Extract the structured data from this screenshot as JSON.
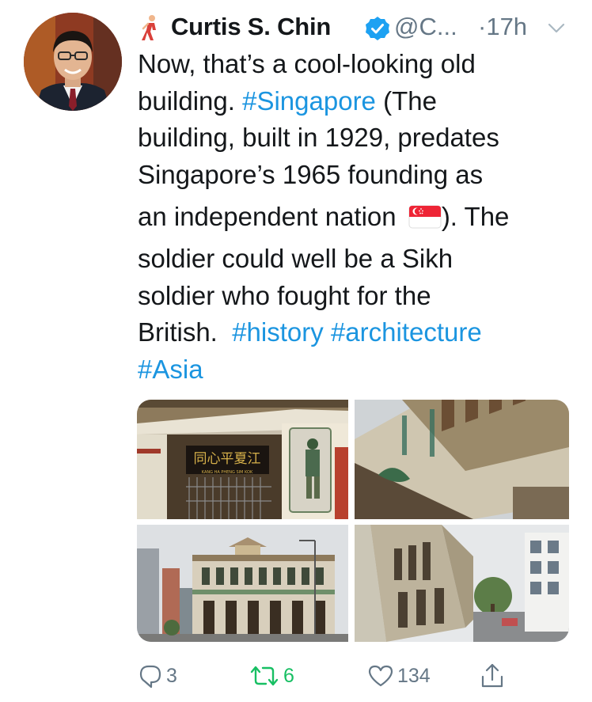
{
  "tweet": {
    "display_name": "Curtis S. Chin",
    "handle": "@C...",
    "timestamp": "·17h",
    "verified": true,
    "header_emoji": "person-walking-icon",
    "text_lines": [
      {
        "segments": [
          {
            "text": "Now, that’s a cool-looking old",
            "type": "text"
          }
        ]
      },
      {
        "segments": [
          {
            "text": "building. ",
            "type": "text"
          },
          {
            "text": "#Singapore",
            "type": "hashtag"
          },
          {
            "text": " (The",
            "type": "text"
          }
        ]
      },
      {
        "segments": [
          {
            "text": "building, built in 1929, predates",
            "type": "text"
          }
        ]
      },
      {
        "segments": [
          {
            "text": "Singapore’s 1965 founding as",
            "type": "text"
          }
        ]
      },
      {
        "segments": [
          {
            "text": "an independent nation ",
            "type": "text"
          },
          {
            "text": "flag-singapore-icon",
            "type": "flag"
          },
          {
            "text": "). The",
            "type": "text"
          }
        ]
      },
      {
        "segments": [
          {
            "text": "soldier could well be a Sikh",
            "type": "text"
          }
        ]
      },
      {
        "segments": [
          {
            "text": "soldier who fought for the",
            "type": "text"
          }
        ]
      },
      {
        "segments": [
          {
            "text": "British.  ",
            "type": "text"
          },
          {
            "text": "#history",
            "type": "hashtag"
          },
          {
            "text": " ",
            "type": "text"
          },
          {
            "text": "#architecture",
            "type": "hashtag"
          }
        ]
      },
      {
        "segments": [
          {
            "text": "#Asia",
            "type": "hashtag"
          }
        ]
      }
    ],
    "media": {
      "photo1_sign": "同心平夏江",
      "photo1_sign_sub": "KANG HA PHENG SIM KOK"
    },
    "actions": {
      "reply_count": "3",
      "retweet_count": "6",
      "like_count": "134"
    }
  },
  "colors": {
    "text": "#14171a",
    "secondary": "#657786",
    "link": "#1b95e0",
    "retweet": "#17bf63",
    "verified": "#1da1f2"
  }
}
